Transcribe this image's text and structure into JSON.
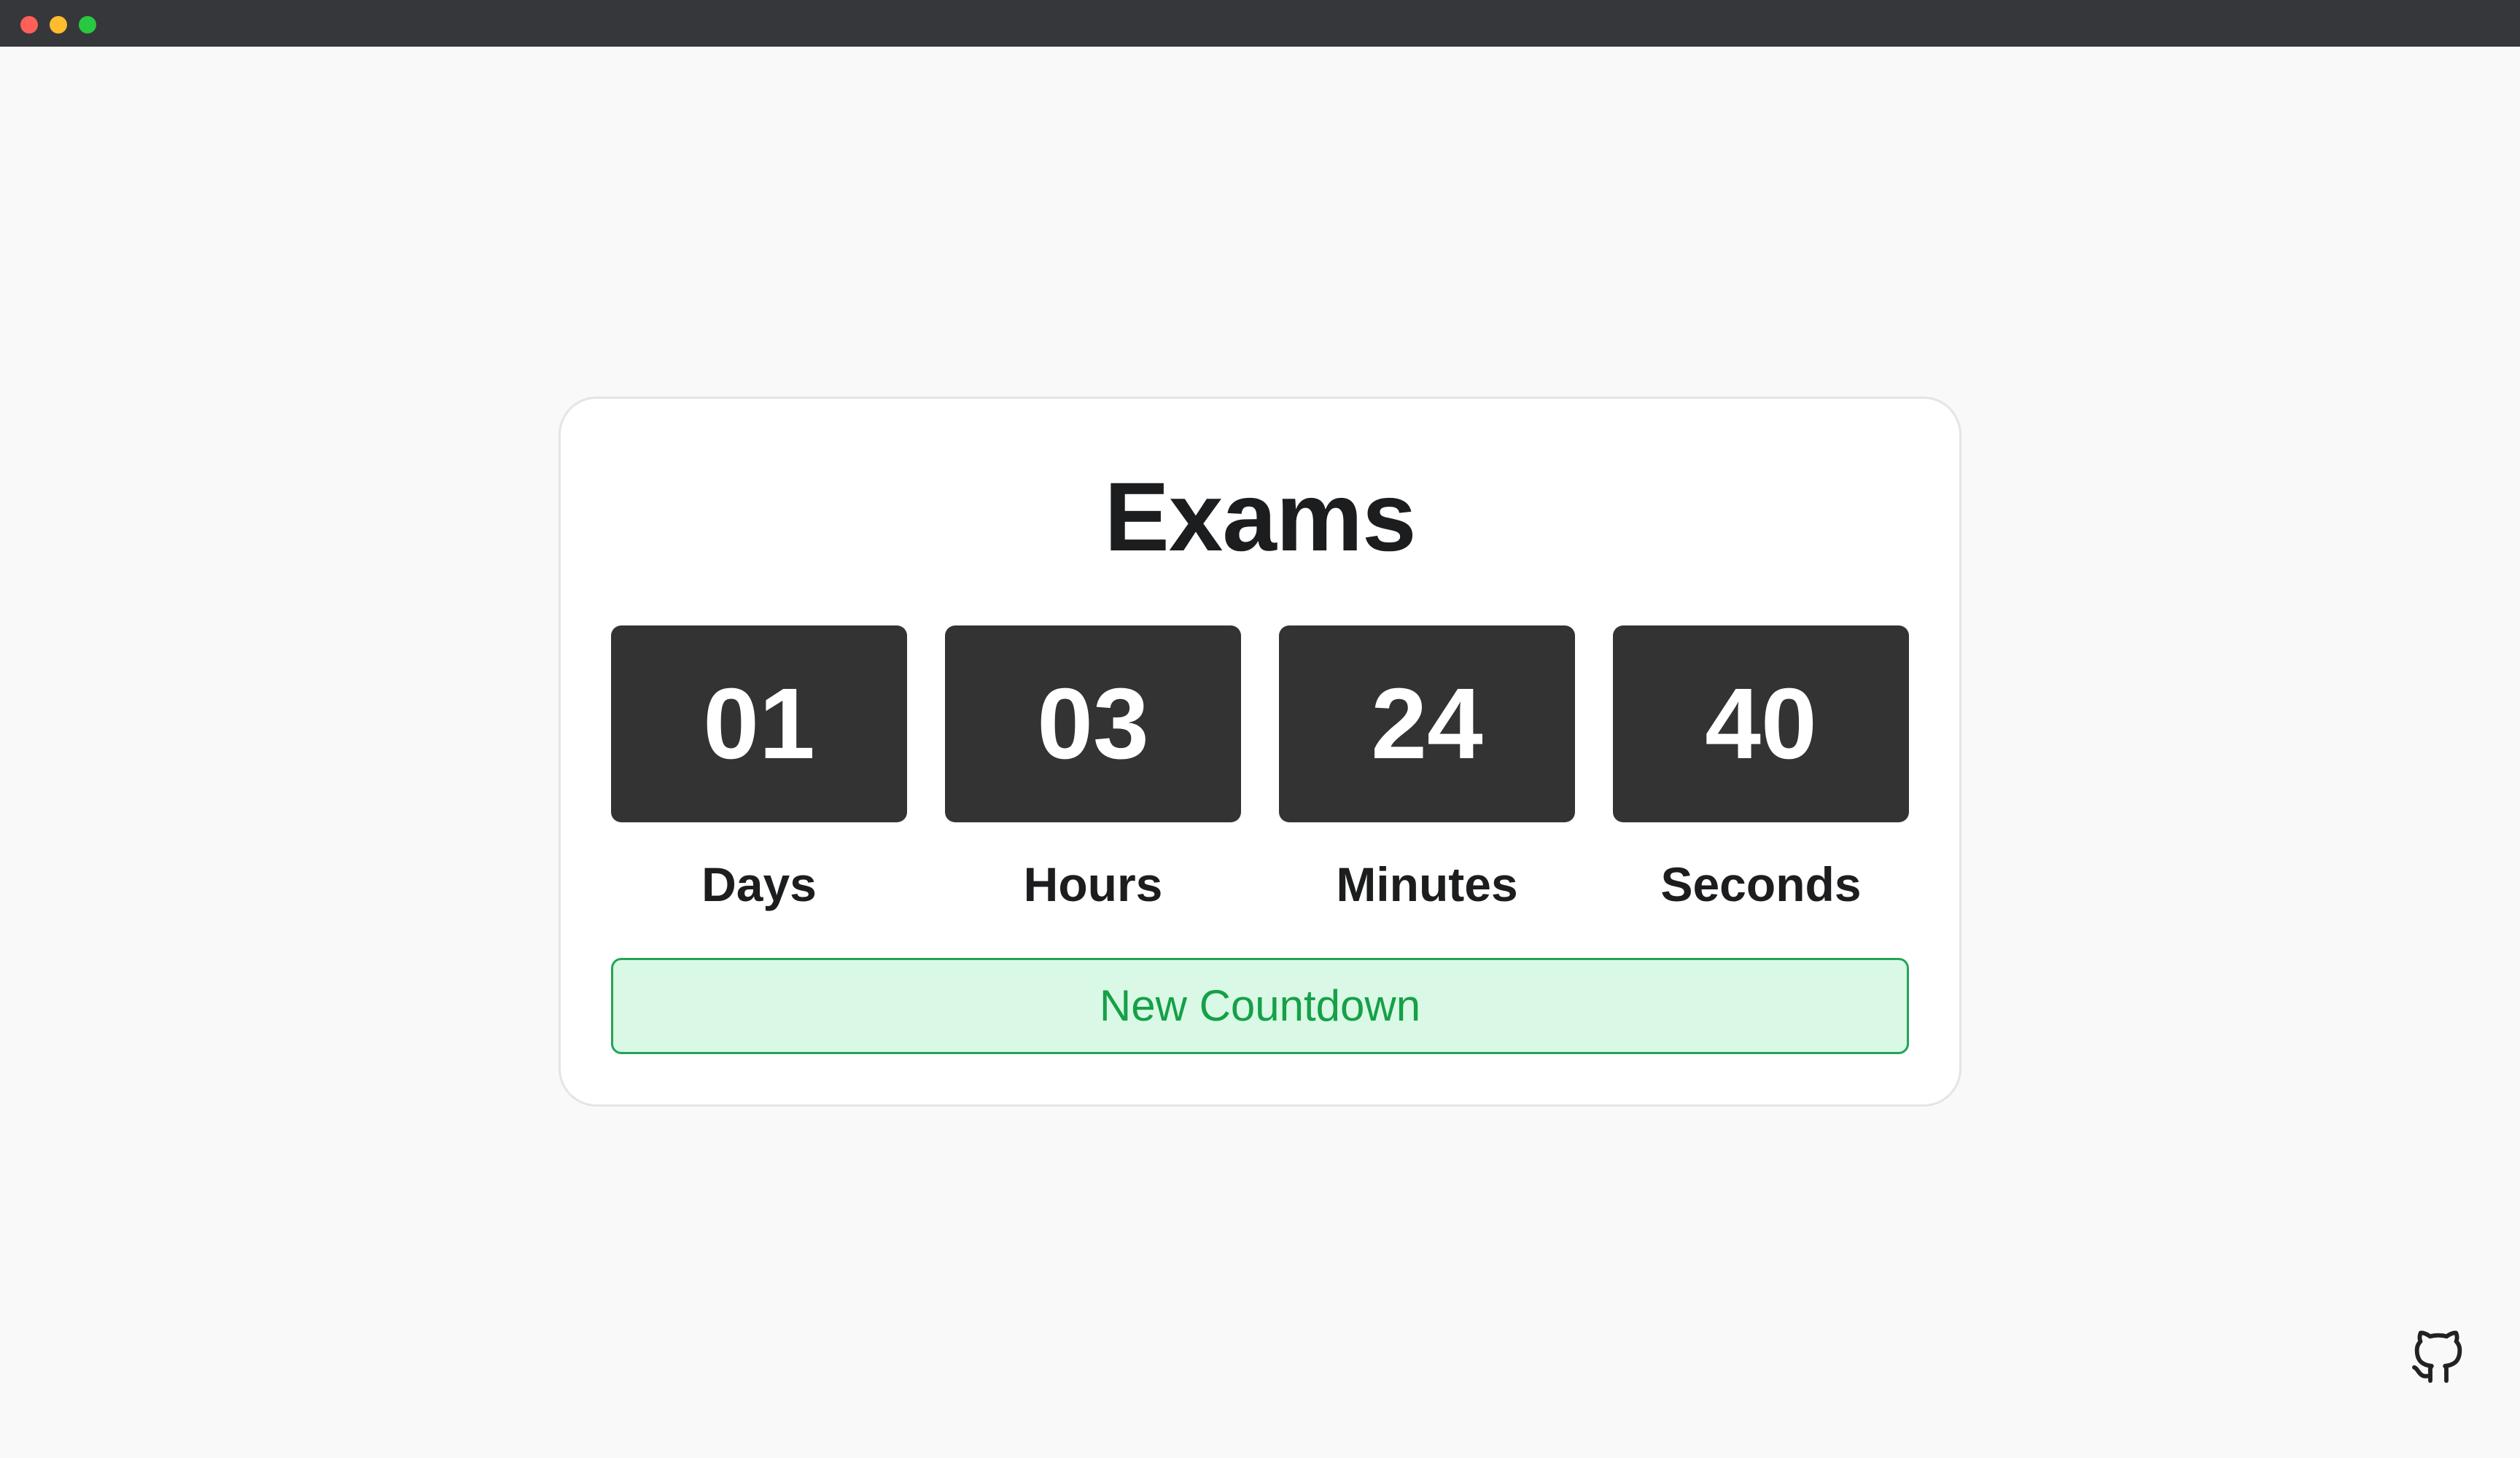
{
  "countdown": {
    "title": "Exams",
    "units": [
      {
        "value": "01",
        "label": "Days"
      },
      {
        "value": "03",
        "label": "Hours"
      },
      {
        "value": "24",
        "label": "Minutes"
      },
      {
        "value": "40",
        "label": "Seconds"
      }
    ]
  },
  "actions": {
    "new_countdown_label": "New Countdown"
  },
  "colors": {
    "background": "#f9f9f9",
    "titlebar": "#36373a",
    "digit_box": "#333333",
    "button_bg": "#d9f9e6",
    "button_border": "#23a455",
    "button_text": "#16a047"
  },
  "icons": {
    "footer_link": "github-icon"
  }
}
